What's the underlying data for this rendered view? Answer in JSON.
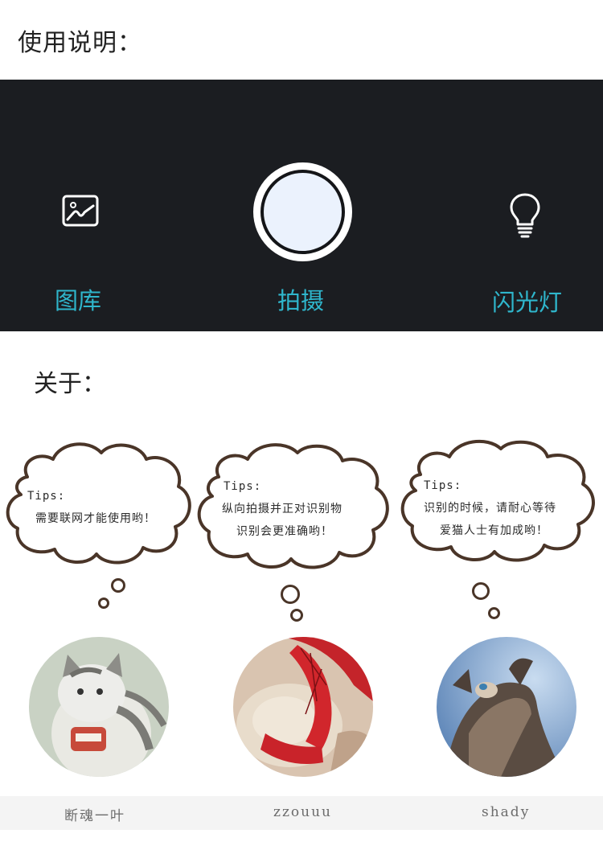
{
  "usage": {
    "title": "使用说明："
  },
  "camera": {
    "gallery_label": "图库",
    "shoot_label": "拍摄",
    "flash_label": "闪光灯"
  },
  "about": {
    "title": "关于："
  },
  "tips": [
    {
      "label": "Tips:",
      "lines": [
        "需要联网才能使用哟！"
      ]
    },
    {
      "label": "Tips:",
      "lines": [
        "纵向拍摄并正对识别物",
        "识别会更准确哟！"
      ]
    },
    {
      "label": "Tips:",
      "lines": [
        "识别的时候，请耐心等待",
        "爱猫人士有加成哟！"
      ]
    }
  ],
  "members": [
    {
      "name": "断魂一叶",
      "avatar": "cartoon-cat-avatar"
    },
    {
      "name": "zzouuu",
      "avatar": "spiderman-cat-avatar"
    },
    {
      "name": "shady",
      "avatar": "fluffy-kitten-avatar"
    }
  ],
  "colors": {
    "accent": "#2fb6cc",
    "panel": "#1b1d21",
    "cloud_outline": "#4a3528"
  }
}
